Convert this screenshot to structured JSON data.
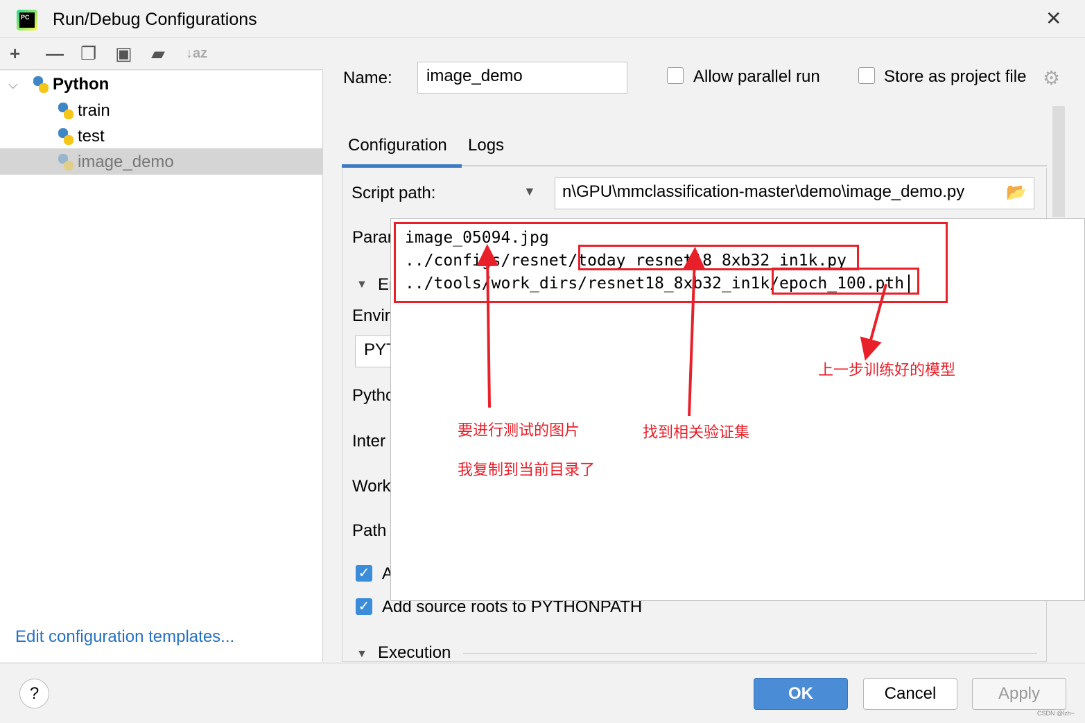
{
  "window": {
    "title": "Run/Debug Configurations",
    "close_icon": "close-icon",
    "app_icon": "pycharm-icon"
  },
  "toolbar": {
    "icons": [
      "plus-icon",
      "minus-icon",
      "copy-icon",
      "save-icon",
      "folder-add-icon",
      "sort-alpha-icon"
    ]
  },
  "tree": {
    "root": "Python",
    "items": [
      "train",
      "test",
      "image_demo"
    ],
    "selected": "image_demo"
  },
  "edit_templates": "Edit configuration templates...",
  "form": {
    "name_label": "Name:",
    "name_value": "image_demo",
    "allow_parallel": "Allow parallel run",
    "allow_parallel_checked": false,
    "store_project": "Store as project file",
    "store_project_checked": false,
    "tabs": [
      "Configuration",
      "Logs"
    ],
    "active_tab": "Configuration",
    "script_label": "Script path:",
    "script_value": "n\\GPU\\mmclassification-master\\demo\\image_demo.py",
    "truncated_labels": [
      "Paran",
      "Er",
      "Envir",
      "PYT",
      "Pytho",
      "Inter",
      "Work",
      "Path",
      "A"
    ],
    "add_source_roots": "Add source roots to PYTHONPATH",
    "add_source_checked": true,
    "add_content_checked": true,
    "execution": "Execution"
  },
  "parameters": {
    "lines": [
      "image_05094.jpg",
      "../configs/resnet/today_resnet18_8xb32_in1k.py",
      "../tools/work_dirs/resnet18_8xb32_in1k/epoch_100.pth"
    ]
  },
  "annotations": {
    "color": "#e8202a",
    "image_note_1": "要进行测试的图片",
    "image_note_2": "我复制到当前目录了",
    "config_note": "找到相关验证集",
    "model_note": "上一步训练好的模型"
  },
  "buttons": {
    "ok": "OK",
    "cancel": "Cancel",
    "apply": "Apply",
    "help": "?"
  },
  "watermark": "CSDN @lzh~"
}
